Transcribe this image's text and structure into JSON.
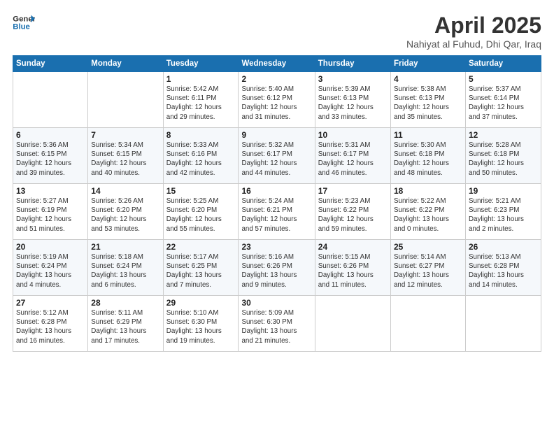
{
  "header": {
    "logo_line1": "General",
    "logo_line2": "Blue",
    "title": "April 2025",
    "subtitle": "Nahiyat al Fuhud, Dhi Qar, Iraq"
  },
  "weekdays": [
    "Sunday",
    "Monday",
    "Tuesday",
    "Wednesday",
    "Thursday",
    "Friday",
    "Saturday"
  ],
  "weeks": [
    [
      {
        "day": "",
        "info": ""
      },
      {
        "day": "",
        "info": ""
      },
      {
        "day": "1",
        "info": "Sunrise: 5:42 AM\nSunset: 6:11 PM\nDaylight: 12 hours\nand 29 minutes."
      },
      {
        "day": "2",
        "info": "Sunrise: 5:40 AM\nSunset: 6:12 PM\nDaylight: 12 hours\nand 31 minutes."
      },
      {
        "day": "3",
        "info": "Sunrise: 5:39 AM\nSunset: 6:13 PM\nDaylight: 12 hours\nand 33 minutes."
      },
      {
        "day": "4",
        "info": "Sunrise: 5:38 AM\nSunset: 6:13 PM\nDaylight: 12 hours\nand 35 minutes."
      },
      {
        "day": "5",
        "info": "Sunrise: 5:37 AM\nSunset: 6:14 PM\nDaylight: 12 hours\nand 37 minutes."
      }
    ],
    [
      {
        "day": "6",
        "info": "Sunrise: 5:36 AM\nSunset: 6:15 PM\nDaylight: 12 hours\nand 39 minutes."
      },
      {
        "day": "7",
        "info": "Sunrise: 5:34 AM\nSunset: 6:15 PM\nDaylight: 12 hours\nand 40 minutes."
      },
      {
        "day": "8",
        "info": "Sunrise: 5:33 AM\nSunset: 6:16 PM\nDaylight: 12 hours\nand 42 minutes."
      },
      {
        "day": "9",
        "info": "Sunrise: 5:32 AM\nSunset: 6:17 PM\nDaylight: 12 hours\nand 44 minutes."
      },
      {
        "day": "10",
        "info": "Sunrise: 5:31 AM\nSunset: 6:17 PM\nDaylight: 12 hours\nand 46 minutes."
      },
      {
        "day": "11",
        "info": "Sunrise: 5:30 AM\nSunset: 6:18 PM\nDaylight: 12 hours\nand 48 minutes."
      },
      {
        "day": "12",
        "info": "Sunrise: 5:28 AM\nSunset: 6:18 PM\nDaylight: 12 hours\nand 50 minutes."
      }
    ],
    [
      {
        "day": "13",
        "info": "Sunrise: 5:27 AM\nSunset: 6:19 PM\nDaylight: 12 hours\nand 51 minutes."
      },
      {
        "day": "14",
        "info": "Sunrise: 5:26 AM\nSunset: 6:20 PM\nDaylight: 12 hours\nand 53 minutes."
      },
      {
        "day": "15",
        "info": "Sunrise: 5:25 AM\nSunset: 6:20 PM\nDaylight: 12 hours\nand 55 minutes."
      },
      {
        "day": "16",
        "info": "Sunrise: 5:24 AM\nSunset: 6:21 PM\nDaylight: 12 hours\nand 57 minutes."
      },
      {
        "day": "17",
        "info": "Sunrise: 5:23 AM\nSunset: 6:22 PM\nDaylight: 12 hours\nand 59 minutes."
      },
      {
        "day": "18",
        "info": "Sunrise: 5:22 AM\nSunset: 6:22 PM\nDaylight: 13 hours\nand 0 minutes."
      },
      {
        "day": "19",
        "info": "Sunrise: 5:21 AM\nSunset: 6:23 PM\nDaylight: 13 hours\nand 2 minutes."
      }
    ],
    [
      {
        "day": "20",
        "info": "Sunrise: 5:19 AM\nSunset: 6:24 PM\nDaylight: 13 hours\nand 4 minutes."
      },
      {
        "day": "21",
        "info": "Sunrise: 5:18 AM\nSunset: 6:24 PM\nDaylight: 13 hours\nand 6 minutes."
      },
      {
        "day": "22",
        "info": "Sunrise: 5:17 AM\nSunset: 6:25 PM\nDaylight: 13 hours\nand 7 minutes."
      },
      {
        "day": "23",
        "info": "Sunrise: 5:16 AM\nSunset: 6:26 PM\nDaylight: 13 hours\nand 9 minutes."
      },
      {
        "day": "24",
        "info": "Sunrise: 5:15 AM\nSunset: 6:26 PM\nDaylight: 13 hours\nand 11 minutes."
      },
      {
        "day": "25",
        "info": "Sunrise: 5:14 AM\nSunset: 6:27 PM\nDaylight: 13 hours\nand 12 minutes."
      },
      {
        "day": "26",
        "info": "Sunrise: 5:13 AM\nSunset: 6:28 PM\nDaylight: 13 hours\nand 14 minutes."
      }
    ],
    [
      {
        "day": "27",
        "info": "Sunrise: 5:12 AM\nSunset: 6:28 PM\nDaylight: 13 hours\nand 16 minutes."
      },
      {
        "day": "28",
        "info": "Sunrise: 5:11 AM\nSunset: 6:29 PM\nDaylight: 13 hours\nand 17 minutes."
      },
      {
        "day": "29",
        "info": "Sunrise: 5:10 AM\nSunset: 6:30 PM\nDaylight: 13 hours\nand 19 minutes."
      },
      {
        "day": "30",
        "info": "Sunrise: 5:09 AM\nSunset: 6:30 PM\nDaylight: 13 hours\nand 21 minutes."
      },
      {
        "day": "",
        "info": ""
      },
      {
        "day": "",
        "info": ""
      },
      {
        "day": "",
        "info": ""
      }
    ]
  ]
}
